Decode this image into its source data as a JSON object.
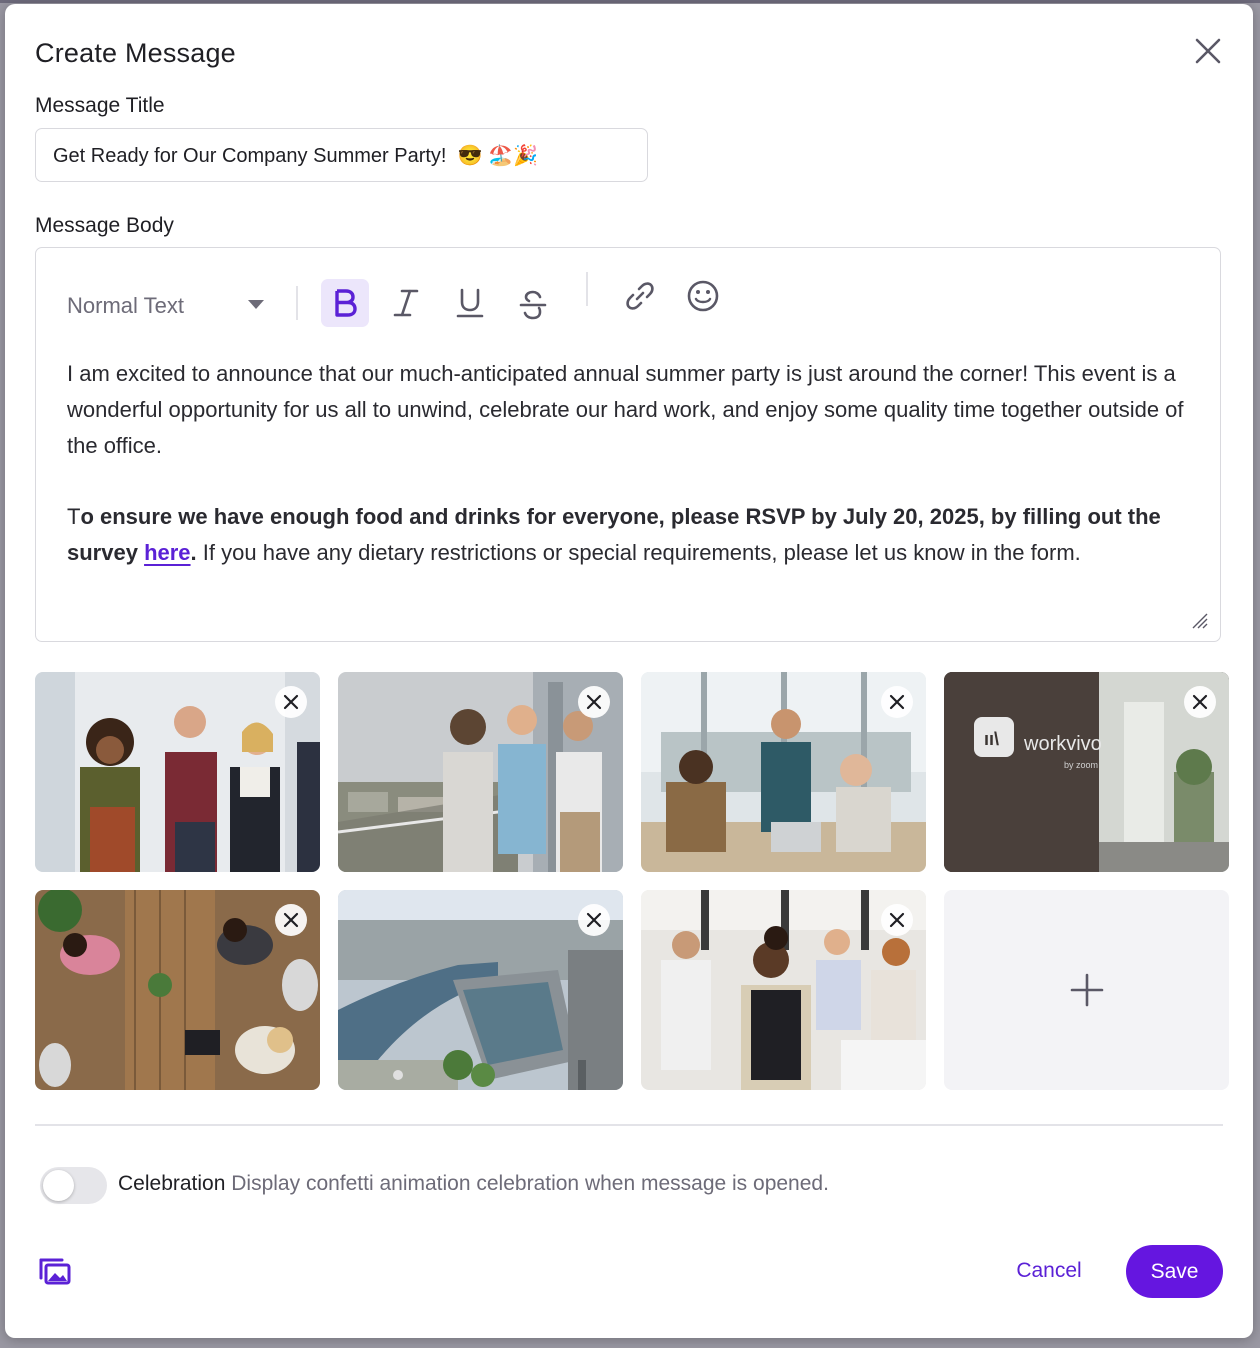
{
  "dialog": {
    "title": "Create Message"
  },
  "title_field": {
    "label": "Message Title",
    "value": "Get Ready for Our Company Summer Party!  😎 🏖️🎉"
  },
  "body_field": {
    "label": "Message Body",
    "toolbar": {
      "text_style": "Normal Text",
      "bold_active": true,
      "icons": [
        "bold-icon",
        "italic-icon",
        "underline-icon",
        "strikethrough-icon",
        "link-icon",
        "emoji-icon"
      ]
    },
    "paragraph1": "I am excited to announce that our much-anticipated annual summer party is just around the corner! This event is a wonderful opportunity for us all to unwind, celebrate our hard work, and enjoy some quality time together outside of the office.",
    "paragraph2": {
      "lead": "T",
      "bold": "o ensure we have enough food and drinks for everyone, please RSVP by July 20, 2025, by filling out the survey ",
      "link": "here",
      "bold_end": ".",
      "rest": " If you have any dietary restrictions or special requirements, please let us know in the form."
    }
  },
  "images": [
    {
      "name": "office-coffee-chat-photo"
    },
    {
      "name": "balcony-city-view-photo"
    },
    {
      "name": "office-laptop-meeting-photo"
    },
    {
      "name": "workvivo-office-sign-photo",
      "sign_text": "workvivo",
      "sign_sub": "by zoom"
    },
    {
      "name": "overhead-desk-photo"
    },
    {
      "name": "river-city-aerial-photo"
    },
    {
      "name": "team-laptop-workshop-photo"
    }
  ],
  "celebration": {
    "label": "Celebration",
    "description": "Display confetti animation celebration when message is opened.",
    "enabled": false
  },
  "footer": {
    "cancel_label": "Cancel",
    "save_label": "Save"
  },
  "colors": {
    "accent": "#6516e0",
    "link": "#5b21d6",
    "bold_active_bg": "#ece6fb"
  }
}
